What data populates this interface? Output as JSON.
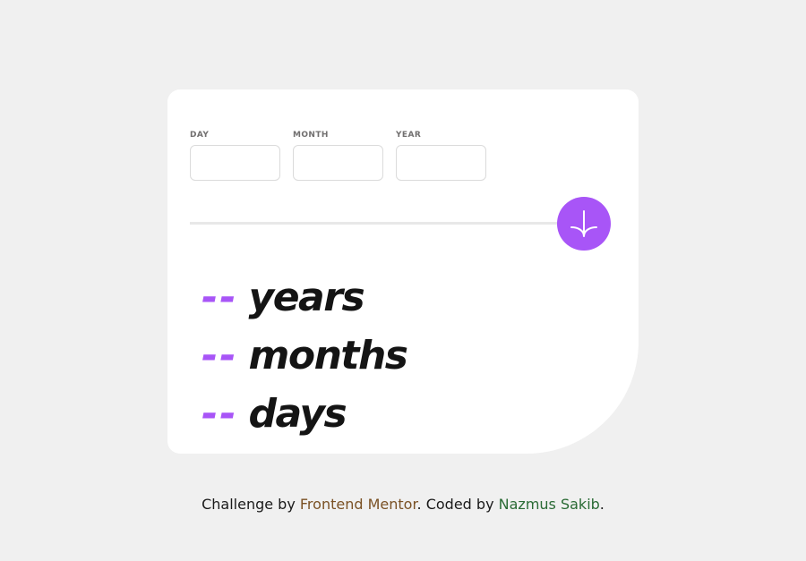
{
  "form": {
    "day": {
      "label": "DAY",
      "value": ""
    },
    "month": {
      "label": "MONTH",
      "value": ""
    },
    "year": {
      "label": "YEAR",
      "value": ""
    }
  },
  "submit": {
    "icon": "arrow-down-icon",
    "color": "#a855f7"
  },
  "results": {
    "years": {
      "value": "--",
      "unit": "years"
    },
    "months": {
      "value": "--",
      "unit": "months"
    },
    "days": {
      "value": "--",
      "unit": "days"
    }
  },
  "footer": {
    "prefix": "Challenge by ",
    "challenge_link": "Frontend Mentor",
    "middle": ". Coded by ",
    "author_link": "Nazmus Sakib",
    "suffix": "."
  },
  "colors": {
    "accent": "#a855f7",
    "background": "#f0f0f0",
    "card": "#ffffff",
    "text": "#141414"
  }
}
